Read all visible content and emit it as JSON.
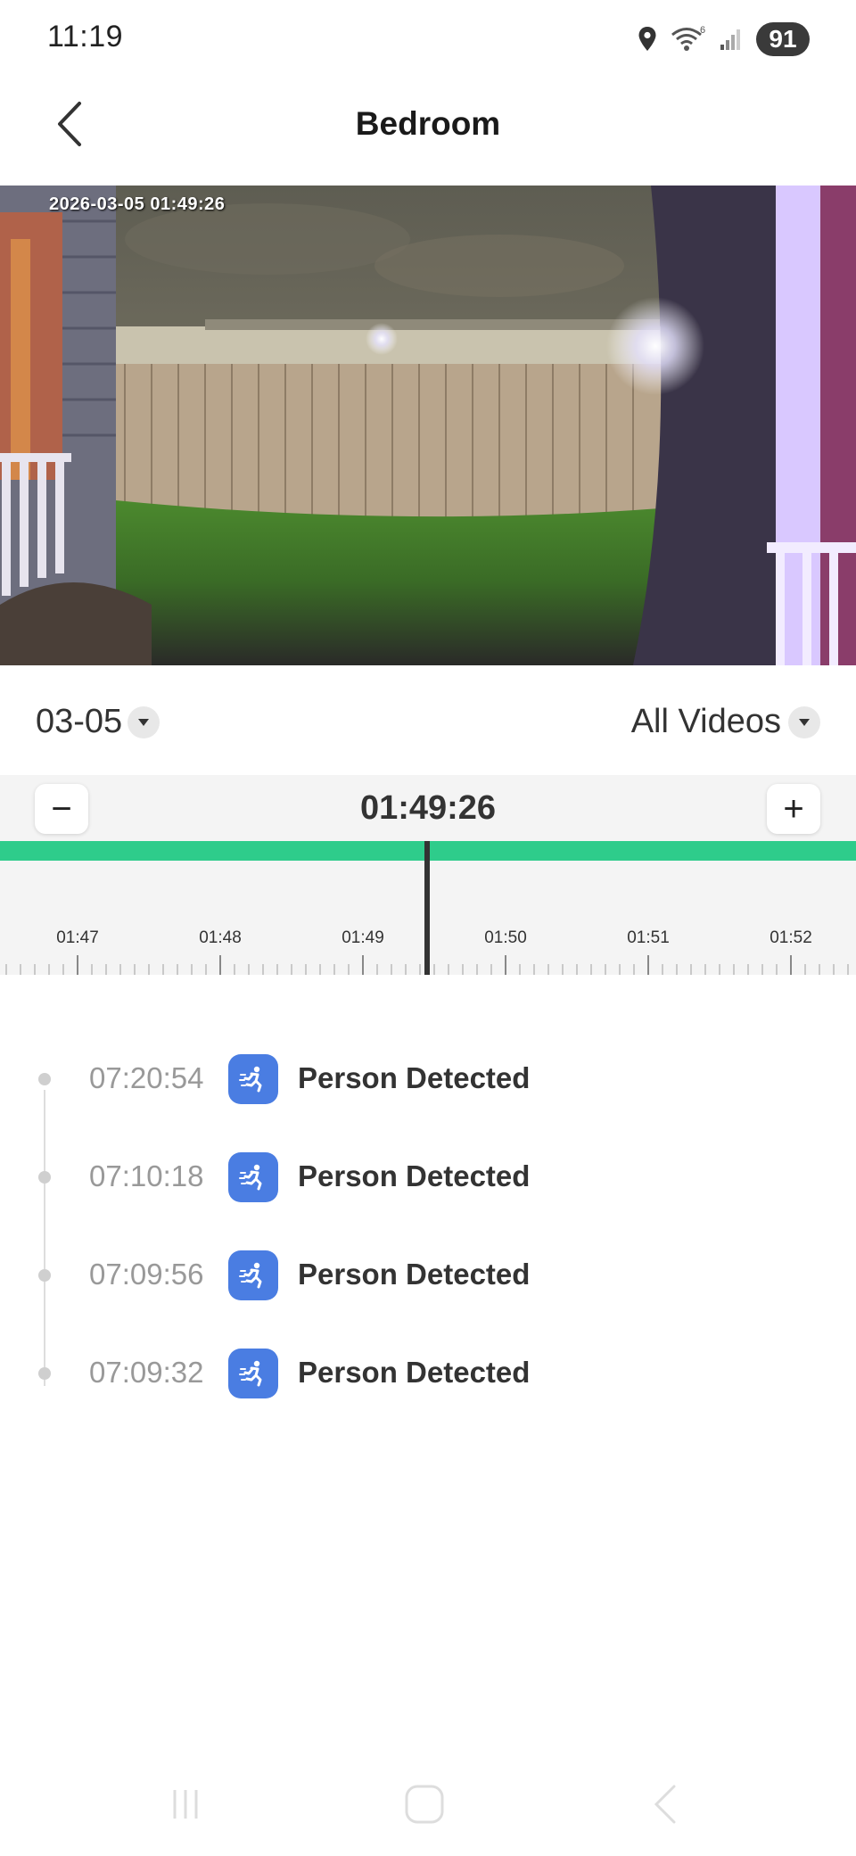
{
  "status_bar": {
    "time": "11:19",
    "battery": "91",
    "icons": [
      "location-icon",
      "wifi-icon",
      "signal-icon",
      "battery-icon"
    ],
    "wifi_badge": "6"
  },
  "header": {
    "title": "Bedroom",
    "back_icon": "chevron-left-icon"
  },
  "video": {
    "timestamp": "2026-03-05  01:49:26"
  },
  "filters": {
    "date": "03-05",
    "video_type": "All Videos"
  },
  "timeline": {
    "current_time": "01:49:26",
    "zoom_out_label": "−",
    "zoom_in_label": "+",
    "tick_labels": [
      "01:47",
      "01:48",
      "01:49",
      "01:50",
      "01:51",
      "01:52"
    ],
    "recording_color": "#2ecc8b"
  },
  "events": [
    {
      "time": "07:20:54",
      "label": "Person Detected",
      "icon": "running-person-icon"
    },
    {
      "time": "07:10:18",
      "label": "Person Detected",
      "icon": "running-person-icon"
    },
    {
      "time": "07:09:56",
      "label": "Person Detected",
      "icon": "running-person-icon"
    },
    {
      "time": "07:09:32",
      "label": "Person Detected",
      "icon": "running-person-icon"
    }
  ],
  "colors": {
    "accent_blue": "#4a7de2",
    "recording_green": "#2ecc8b"
  }
}
